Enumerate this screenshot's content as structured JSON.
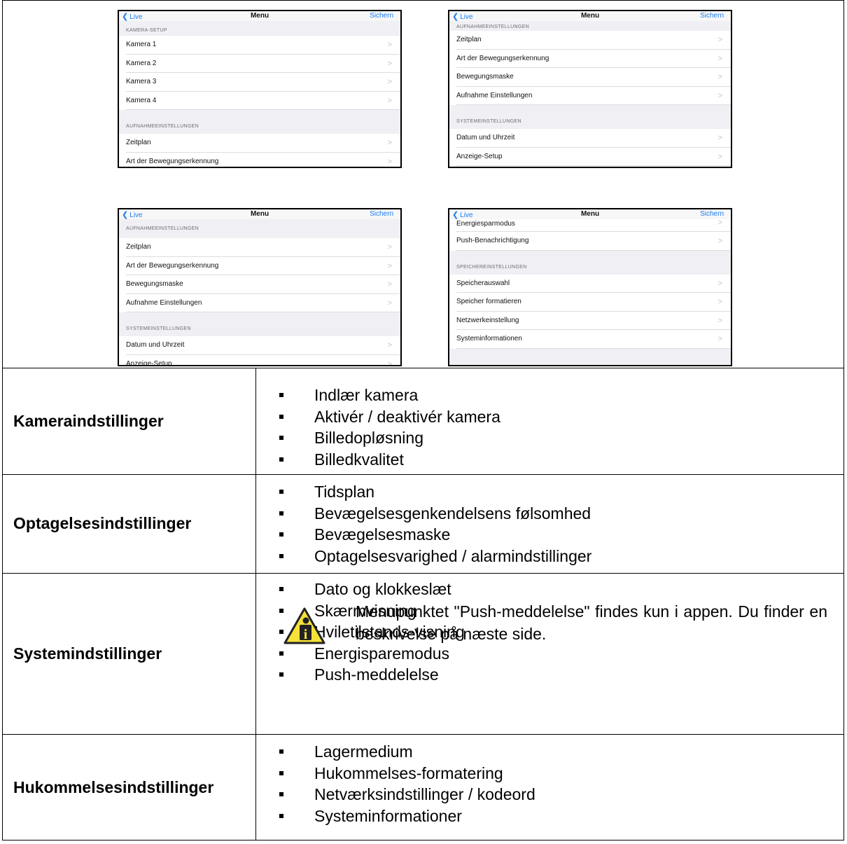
{
  "screens": [
    {
      "nav": {
        "back": "Live",
        "title": "Menu",
        "save": "Sichern"
      },
      "sections": [
        {
          "header": "KAMERA-SETUP",
          "items": [
            "Kamera 1",
            "Kamera 2",
            "Kamera 3",
            "Kamera 4"
          ]
        },
        {
          "header": "AUFNAHMEEINSTELLUNGEN",
          "items": [
            "Zeitplan",
            "Art der Bewegungserkennung"
          ]
        }
      ]
    },
    {
      "nav": {
        "back": "Live",
        "title": "Menu",
        "save": "Sichern"
      },
      "sections": [
        {
          "header": "AUFNAHMEEINSTELLUNGEN",
          "items": [
            "Zeitplan",
            "Art der Bewegungserkennung",
            "Bewegungsmaske",
            "Aufnahme Einstellungen"
          ]
        },
        {
          "header": "SYSTEMEINSTELLUNGEN",
          "items": [
            "Datum und Uhrzeit",
            "Anzeige-Setup"
          ]
        }
      ]
    },
    {
      "nav": {
        "back": "Live",
        "title": "Menu",
        "save": "Sichern"
      },
      "sections": [
        {
          "header": "AUFNAHMEEINSTELLUNGEN",
          "items": [
            "Zeitplan",
            "Art der Bewegungserkennung",
            "Bewegungsmaske",
            "Aufnahme Einstellungen"
          ]
        },
        {
          "header": "SYSTEMEINSTELLUNGEN",
          "items": [
            "Datum und Uhrzeit",
            "Anzeige-Setup"
          ]
        }
      ]
    },
    {
      "nav": {
        "back": "Live",
        "title": "Menu",
        "save": "Sichern"
      },
      "top_items": [
        "Energiesparmodus",
        "Push-Benachrichtigung"
      ],
      "sections": [
        {
          "header": "SPEICHEREINSTELLUNGEN",
          "items": [
            "Speicherauswahl",
            "Speicher formatieren",
            "Netzwerkeinstellung",
            "Systeminformationen"
          ]
        }
      ]
    }
  ],
  "table": [
    {
      "category": "Kameraindstillinger",
      "items": [
        "Indlær kamera",
        "Aktivér / deaktivér kamera",
        "Billedopløsning",
        "Billedkvalitet"
      ]
    },
    {
      "category": "Optagelsesindstillinger",
      "items": [
        "Tidsplan",
        "Bevægelsesgenkendelsens følsomhed",
        "Bevægelsesmaske",
        "Optagelsesvarighed / alarmindstillinger"
      ]
    },
    {
      "category": "Systemindstillinger",
      "items": [
        "Dato og klokkeslæt",
        "Skærmvisning",
        "Hviletilstands-visning",
        "Energisparemodus",
        "Push-meddelelse"
      ],
      "note": "Menupunktet \"Push-meddelelse\" findes kun i appen. Du finder en beskrivelse på næste side."
    },
    {
      "category": "Hukommelsesindstillinger",
      "items": [
        "Lagermedium",
        "Hukommelses-formatering",
        "Netværksindstillinger / kodeord",
        "Systeminformationer"
      ]
    }
  ]
}
